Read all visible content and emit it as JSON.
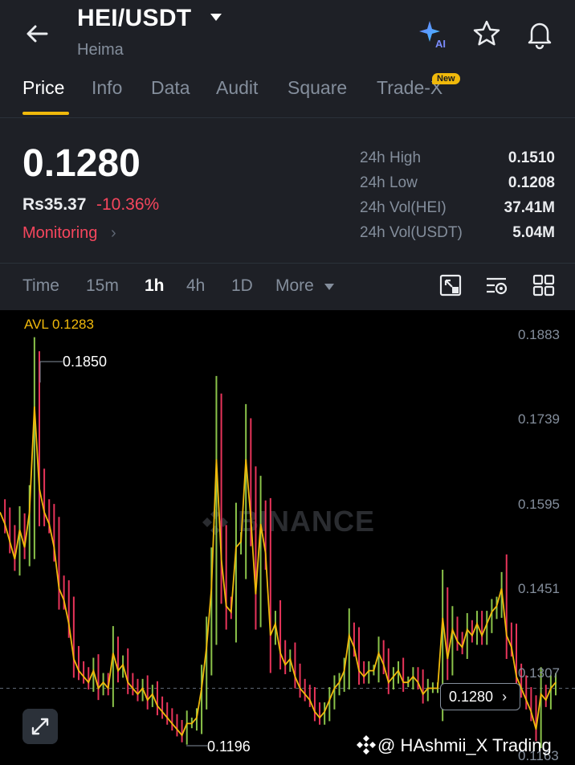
{
  "header": {
    "pair": "HEI/USDT",
    "name": "Heima",
    "icons": [
      "back-arrow-icon",
      "ai-sparkle-icon",
      "star-icon",
      "bell-icon"
    ]
  },
  "tabs": [
    {
      "label": "Price",
      "active": true
    },
    {
      "label": "Info"
    },
    {
      "label": "Data"
    },
    {
      "label": "Audit"
    },
    {
      "label": "Square"
    },
    {
      "label": "Trade-X",
      "badge": "New"
    }
  ],
  "price": {
    "last": "0.1280",
    "fiat": "Rs35.37",
    "change": "-10.36%",
    "monitoring": "Monitoring",
    "stats": [
      {
        "label": "24h High",
        "value": "0.1510"
      },
      {
        "label": "24h Low",
        "value": "0.1208"
      },
      {
        "label": "24h Vol(HEI)",
        "value": "37.41M"
      },
      {
        "label": "24h Vol(USDT)",
        "value": "5.04M"
      }
    ]
  },
  "intervals": {
    "items": [
      "Time",
      "15m",
      "1h",
      "4h",
      "1D",
      "More"
    ],
    "active": "1h",
    "tools": [
      "fullscreen-icon",
      "indicator-settings-icon",
      "layout-grid-icon"
    ]
  },
  "chart": {
    "avl_label": "AVL 0.1283",
    "watermark": "BINANCE",
    "high_label": "0.1850",
    "low_label": "0.1196",
    "current_label": "0.1280",
    "credit": "@ HAshmii_X Trading",
    "colors": {
      "up": "#8bc34a",
      "down": "#e8345a",
      "avg": "#f0b90b"
    }
  },
  "chart_data": {
    "type": "line",
    "y_ticks": [
      "0.1883",
      "0.1739",
      "0.1595",
      "0.1451",
      "0.1307",
      "0.1163"
    ],
    "ylim": [
      0.1163,
      0.1883
    ],
    "current_price": 0.128,
    "high": 0.185,
    "low": 0.1196,
    "series": [
      {
        "name": "AVL",
        "values": [
          0.158,
          0.156,
          0.153,
          0.15,
          0.155,
          0.152,
          0.158,
          0.176,
          0.162,
          0.158,
          0.156,
          0.152,
          0.145,
          0.143,
          0.139,
          0.133,
          0.131,
          0.13,
          0.129,
          0.131,
          0.128,
          0.129,
          0.128,
          0.134,
          0.131,
          0.132,
          0.129,
          0.128,
          0.127,
          0.128,
          0.126,
          0.127,
          0.125,
          0.124,
          0.123,
          0.122,
          0.121,
          0.12,
          0.122,
          0.122,
          0.123,
          0.128,
          0.135,
          0.145,
          0.167,
          0.15,
          0.142,
          0.141,
          0.152,
          0.153,
          0.167,
          0.157,
          0.144,
          0.156,
          0.151,
          0.137,
          0.139,
          0.134,
          0.132,
          0.133,
          0.13,
          0.128,
          0.127,
          0.126,
          0.124,
          0.123,
          0.124,
          0.126,
          0.128,
          0.129,
          0.131,
          0.137,
          0.135,
          0.131,
          0.13,
          0.131,
          0.131,
          0.134,
          0.132,
          0.129,
          0.13,
          0.131,
          0.129,
          0.129,
          0.13,
          0.129,
          0.127,
          0.128,
          0.128,
          0.128,
          0.14,
          0.133,
          0.138,
          0.136,
          0.135,
          0.138,
          0.137,
          0.139,
          0.137,
          0.139,
          0.141,
          0.142,
          0.145,
          0.137,
          0.135,
          0.13,
          0.128,
          0.126,
          0.124,
          0.121,
          0.127,
          0.126,
          0.128,
          0.129
        ]
      }
    ]
  }
}
